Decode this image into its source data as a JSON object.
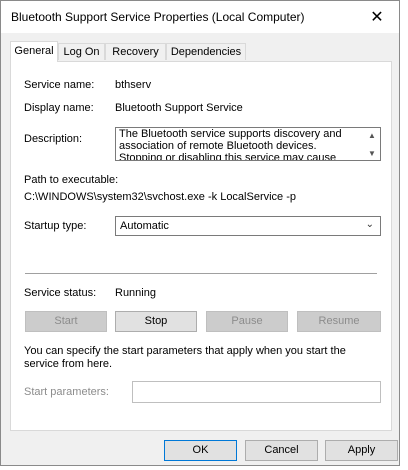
{
  "window": {
    "title": "Bluetooth Support Service Properties (Local Computer)",
    "close_glyph": "✕"
  },
  "tabs": [
    {
      "label": "General",
      "active": true
    },
    {
      "label": "Log On",
      "active": false
    },
    {
      "label": "Recovery",
      "active": false
    },
    {
      "label": "Dependencies",
      "active": false
    }
  ],
  "general": {
    "service_name_label": "Service name:",
    "service_name": "bthserv",
    "display_name_label": "Display name:",
    "display_name": "Bluetooth Support Service",
    "description_label": "Description:",
    "description": "The Bluetooth service supports discovery and association of remote Bluetooth devices.  Stopping or disabling this service may cause already installed",
    "path_label": "Path to executable:",
    "path": "C:\\WINDOWS\\system32\\svchost.exe -k LocalService -p",
    "startup_type_label": "Startup type:",
    "startup_type": "Automatic",
    "service_status_label": "Service status:",
    "service_status": "Running",
    "buttons": {
      "start": "Start",
      "stop": "Stop",
      "pause": "Pause",
      "resume": "Resume"
    },
    "start_params_note": "You can specify the start parameters that apply when you start the service from here.",
    "start_params_label": "Start parameters:",
    "start_params_value": ""
  },
  "footer": {
    "ok": "OK",
    "cancel": "Cancel",
    "apply": "Apply"
  },
  "icons": {
    "scroll_up": "up-arrow-icon",
    "scroll_down": "down-arrow-icon",
    "dropdown": "chevron-down-icon"
  },
  "colors": {
    "primary_border": "#0078d7",
    "disabled_text": "#8c8c8c"
  }
}
